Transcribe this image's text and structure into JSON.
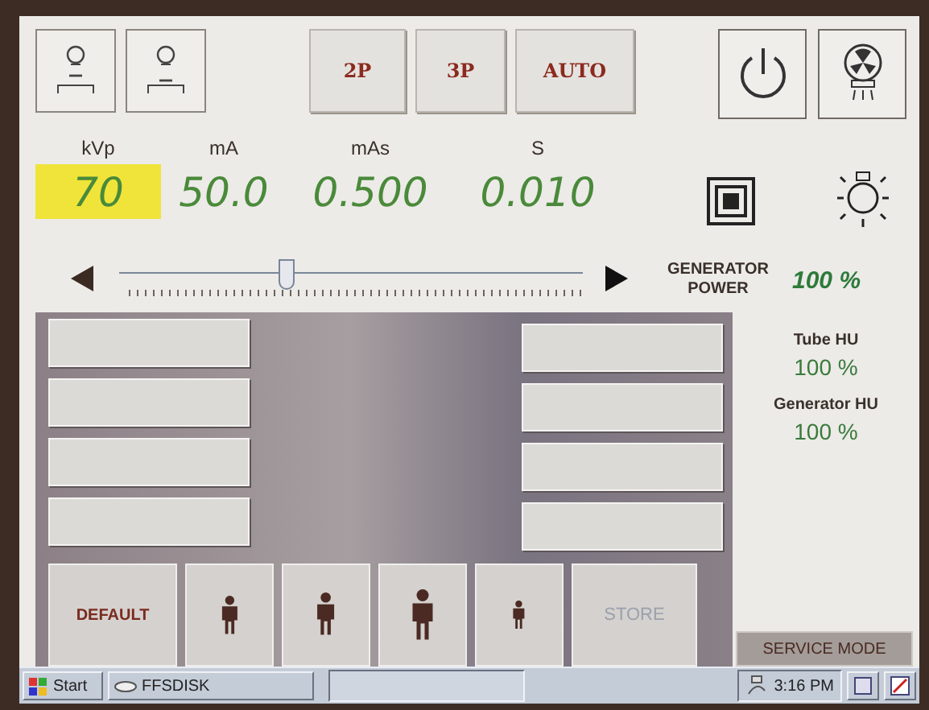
{
  "mode_buttons": [
    {
      "label": "2P"
    },
    {
      "label": "3P"
    },
    {
      "label": "AUTO"
    }
  ],
  "parameters": [
    {
      "label": "kVp",
      "value": "70",
      "selected": true
    },
    {
      "label": "mA",
      "value": "50.0",
      "selected": false
    },
    {
      "label": "mAs",
      "value": "0.500",
      "selected": false
    },
    {
      "label": "S",
      "value": "0.010",
      "selected": false
    }
  ],
  "slider": {
    "level": 0.36
  },
  "generator_power": {
    "label": "GENERATOR POWER",
    "value": "100 %"
  },
  "status": [
    {
      "label": "Tube HU",
      "value": "100 %"
    },
    {
      "label": "Generator HU",
      "value": "100 %"
    }
  ],
  "bottom_buttons": [
    {
      "kind": "text",
      "label": "DEFAULT",
      "disabled": false
    },
    {
      "kind": "slim"
    },
    {
      "kind": "medium"
    },
    {
      "kind": "large"
    },
    {
      "kind": "child"
    },
    {
      "kind": "text",
      "label": "STORE",
      "disabled": true
    }
  ],
  "service_button": "SERVICE MODE",
  "taskbar": {
    "start": "Start",
    "task": "FFSDISK",
    "clock": "3:16 PM"
  }
}
